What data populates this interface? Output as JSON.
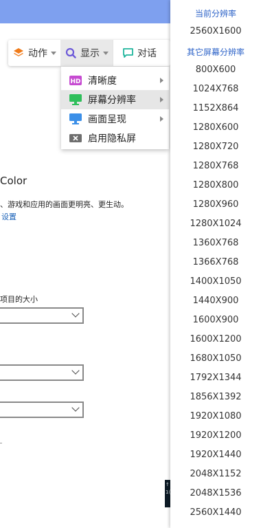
{
  "toolbar": {
    "action_label": "动作",
    "display_label": "显示",
    "chat_label": "对话"
  },
  "display_menu": {
    "items": [
      {
        "label": "清晰度",
        "icon": "hd-icon",
        "has_submenu": true
      },
      {
        "label": "屏幕分辨率",
        "icon": "monitor-green-icon",
        "has_submenu": true
      },
      {
        "label": "画面呈现",
        "icon": "monitor-blue-icon",
        "has_submenu": true
      },
      {
        "label": "启用隐私屏",
        "icon": "privacy-screen-icon",
        "has_submenu": false
      }
    ]
  },
  "background": {
    "color_heading": "Color",
    "description": "、游戏和应用的画面更明亮、更生动。",
    "settings_link": "设置",
    "scale_label": "项目的大小"
  },
  "dark_strip": {
    "glyph1": "↑",
    "glyph2": "1("
  },
  "resolution_panel": {
    "current_header": "当前分辨率",
    "current_value": "2560X1600",
    "other_header": "其它屏幕分辨率",
    "options": [
      "800X600",
      "1024X768",
      "1152X864",
      "1280X600",
      "1280X720",
      "1280X768",
      "1280X800",
      "1280X960",
      "1280X1024",
      "1360X768",
      "1366X768",
      "1400X1050",
      "1440X900",
      "1600X900",
      "1600X1200",
      "1680X1050",
      "1792X1344",
      "1856X1392",
      "1920X1080",
      "1920X1200",
      "1920X1440",
      "2048X1152",
      "2048X1536",
      "2560X1440"
    ]
  },
  "colors": {
    "accent_blue": "#2d63c8",
    "topbar": "#7ea0ef",
    "action_orange": "#f07b1a",
    "display_purple": "#6b58d8",
    "chat_teal": "#1fb59c"
  }
}
